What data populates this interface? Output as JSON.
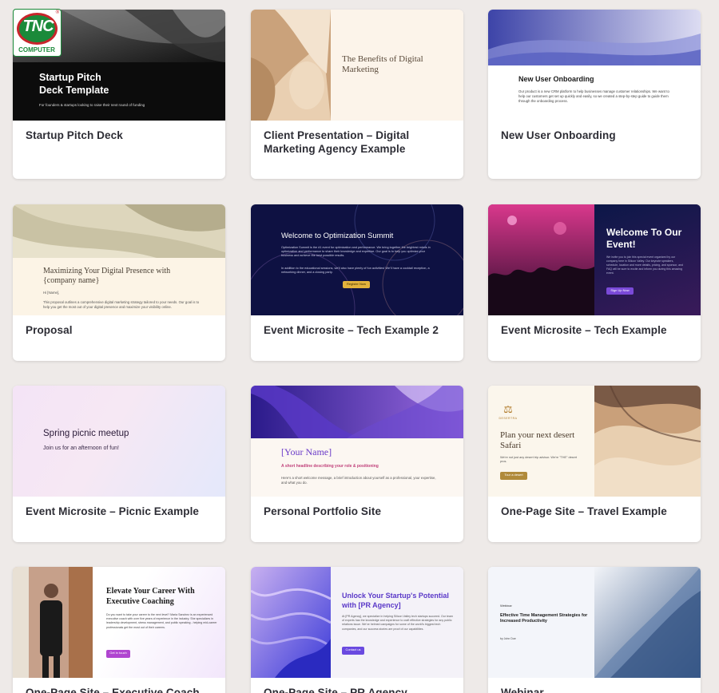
{
  "watermark": {
    "main": "TNC",
    "sub": "COMPUTER",
    "mark": "®"
  },
  "cards": [
    {
      "title": "Startup Pitch Deck",
      "thumb": {
        "heading": "Startup Pitch\nDeck Template",
        "body": "For founders & startups looking to raise their next round of funding"
      }
    },
    {
      "title": "Client Presentation – Digital Marketing Agency Example",
      "thumb": {
        "heading": "The Benefits of Digital Marketing"
      }
    },
    {
      "title": "New User Onboarding",
      "thumb": {
        "heading": "New User Onboarding",
        "body": "Our product is a new CRM platform to help businesses manage customer relationships. We want to help our customers get set up quickly and easily, so we created a step-by-step guide to guide them through the onboarding process."
      }
    },
    {
      "title": "Proposal",
      "thumb": {
        "heading": "Maximizing Your Digital Presence with {company name}",
        "greeting": "Hi [Name],",
        "body": "This proposal outlines a comprehensive digital marketing strategy tailored to your needs. Our goal is to help you get the most out of your digital presence and maximize your visibility online."
      }
    },
    {
      "title": "Event Microsite – Tech Example 2",
      "thumb": {
        "heading": "Welcome to Optimization Summit",
        "body": "Optimization Summit is the #1 event for optimization and performance. We bring together the brightest minds in optimization and performance to share their knowledge and expertise. Our goal is to help you optimize your business and achieve the best possible results.",
        "body2": "In addition to the educational sessions, we'll also have plenty of fun activities! We'll have a cocktail reception, a networking dinner, and a closing party.",
        "button": "Register Now"
      }
    },
    {
      "title": "Event Microsite – Tech Example",
      "thumb": {
        "heading": "Welcome To Our Event!",
        "body": "We invite you to join this special event organized by our company here in Silicon Valley. Our keynote speakers, schedule, location and more details, pricing, and sponsor, and FAQ will be sure to excite and inform you during this amazing event.",
        "button": "Sign Up Now"
      }
    },
    {
      "title": "Event Microsite – Picnic Example",
      "thumb": {
        "heading": "Spring picnic meetup",
        "sub": "Join us for an afternoon of fun!"
      }
    },
    {
      "title": "Personal Portfolio Site",
      "thumb": {
        "heading": "[Your Name]",
        "sub": "A short headline describing your role & positioning",
        "body": "Here's a short welcome message, a brief introduction about yourself as a professional, your expertise, and what you do."
      }
    },
    {
      "title": "One-Page Site – Travel Example",
      "thumb": {
        "brand": "DESERTRA",
        "heading": "Plan your next desert Safari",
        "body": "We're not just any desert trip advisor. We're \"THE\" desert pros.",
        "button": "Tour a desert"
      }
    },
    {
      "title": "One-Page Site – Executive Coach",
      "thumb": {
        "heading": "Elevate Your Career With Executive Coaching",
        "body": "Do you want to take your career to the next level? Maria Sanchez is an experienced executive coach with over five years of experience in the industry. She specializes in leadership development, stress management, and public speaking - helping mid-career professionals get the most out of their careers.",
        "button": "Get in touch"
      }
    },
    {
      "title": "One-Page Site – PR Agency Example",
      "thumb": {
        "heading": "Unlock Your Startup's Potential with [PR Agency]",
        "body": "At [PR Agency], we specialize in helping Silicon Valley tech startups succeed. Our team of experts has the knowledge and experience to craft effective strategies for any public relations issue. We've helmed campaigns for some of the world's biggest tech companies, and our success stories are proof of our capabilities.",
        "button": "Contact us"
      }
    },
    {
      "title": "Webinar",
      "thumb": {
        "label": "Webinar",
        "heading": "Effective Time Management Strategies for Increased Productivity",
        "byline": "by John Doe"
      }
    }
  ]
}
